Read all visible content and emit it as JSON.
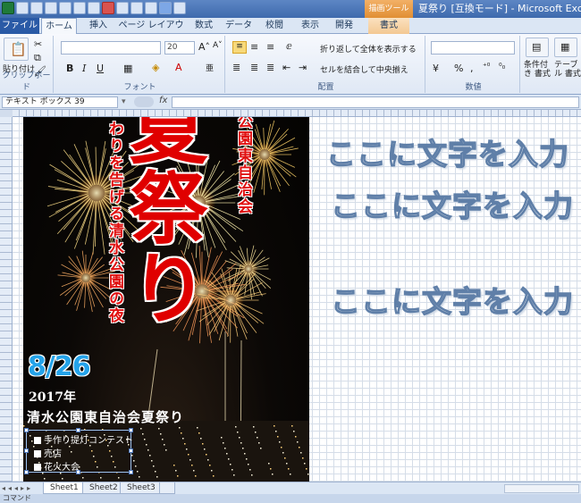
{
  "window": {
    "title": "夏祭り [互換モード] - Microsoft Excel",
    "context_tool": "描画ツール"
  },
  "ribbon_tabs": [
    "ファイル",
    "ホーム",
    "挿入",
    "ページ レイアウト",
    "数式",
    "データ",
    "校閲",
    "表示",
    "開発",
    "書式"
  ],
  "ribbon": {
    "clipboard": {
      "paste": "貼り付け",
      "label": "クリップボード"
    },
    "font": {
      "size": "20",
      "label": "フォント",
      "bold": "B",
      "italic": "I",
      "underline": "U"
    },
    "alignment": {
      "wrap": "折り返して全体を表示する",
      "merge": "セルを結合して中央揃え",
      "label": "配置"
    },
    "number": {
      "label": "数値",
      "percent": "%"
    },
    "styles": {
      "conditional": "条件付き 書式",
      "table": "テーブル 書式"
    }
  },
  "formula_bar": {
    "name_box": "テキスト ボックス 39",
    "fx": "fx"
  },
  "poster": {
    "left_vertical": "わりを告げる清水公園の夜",
    "right_vertical": "公園東自治会",
    "big_title": "夏祭り",
    "date": "8/26",
    "year": "2017年",
    "festival_name": "清水公園東自治会夏祭り",
    "events": [
      "手作り提灯コンテスト",
      "売店",
      "花火大会"
    ]
  },
  "placeholders": [
    "ここに文字を入力",
    "ここに文字を入力",
    "ここに文字を入力"
  ],
  "sheets": [
    "Sheet1",
    "Sheet2",
    "Sheet3"
  ],
  "status": "コマンド"
}
